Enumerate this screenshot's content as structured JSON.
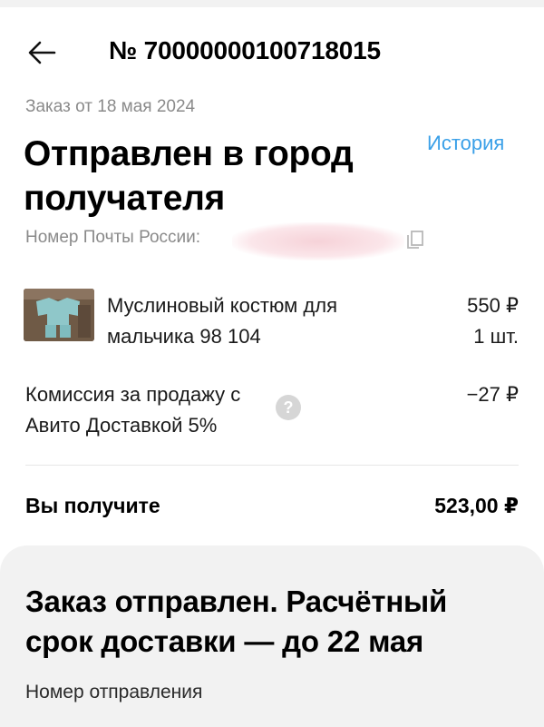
{
  "header": {
    "order_number": "№ 70000000100718015"
  },
  "order": {
    "date": "Заказ от 18 мая 2024",
    "status": "Отправлен в город получателя",
    "history_label": "История",
    "tracking_label": "Номер Почты России:"
  },
  "product": {
    "name": "Муслиновый костюм для мальчика 98 104",
    "price": "550 ₽",
    "quantity": "1 шт."
  },
  "fee": {
    "label": "Комиссия за продажу с Авито Доставкой 5%",
    "amount": "−27 ₽",
    "help_icon": "?"
  },
  "total": {
    "label": "Вы получите",
    "amount": "523,00 ₽"
  },
  "shipment": {
    "title": "Заказ отправлен. Расчётный срок доставки — до 22 мая",
    "subtitle": "Номер отправления"
  },
  "colors": {
    "accent_link": "#3aa0e8",
    "muted_text": "#8a8a8a",
    "card_background": "#f2f2f2"
  },
  "icons": {
    "back": "arrow-left-icon",
    "copy": "copy-icon",
    "help": "question-icon"
  }
}
